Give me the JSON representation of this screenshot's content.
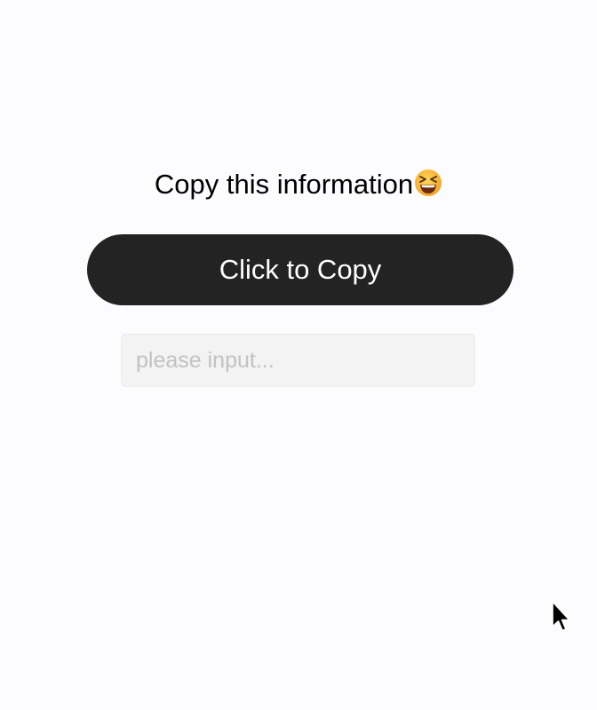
{
  "message": {
    "text": "Copy this information",
    "emoji_icon": "grinning-squinting-face-icon"
  },
  "copy_button": {
    "label": "Click to Copy"
  },
  "input": {
    "value": "",
    "placeholder": "please input..."
  },
  "colors": {
    "background": "#fcfcfe",
    "button_background": "#232323",
    "button_text": "#ffffff",
    "input_background": "#f3f3f3",
    "placeholder": "#c2c2c2"
  },
  "cursor_icon": "mouse-pointer-icon"
}
